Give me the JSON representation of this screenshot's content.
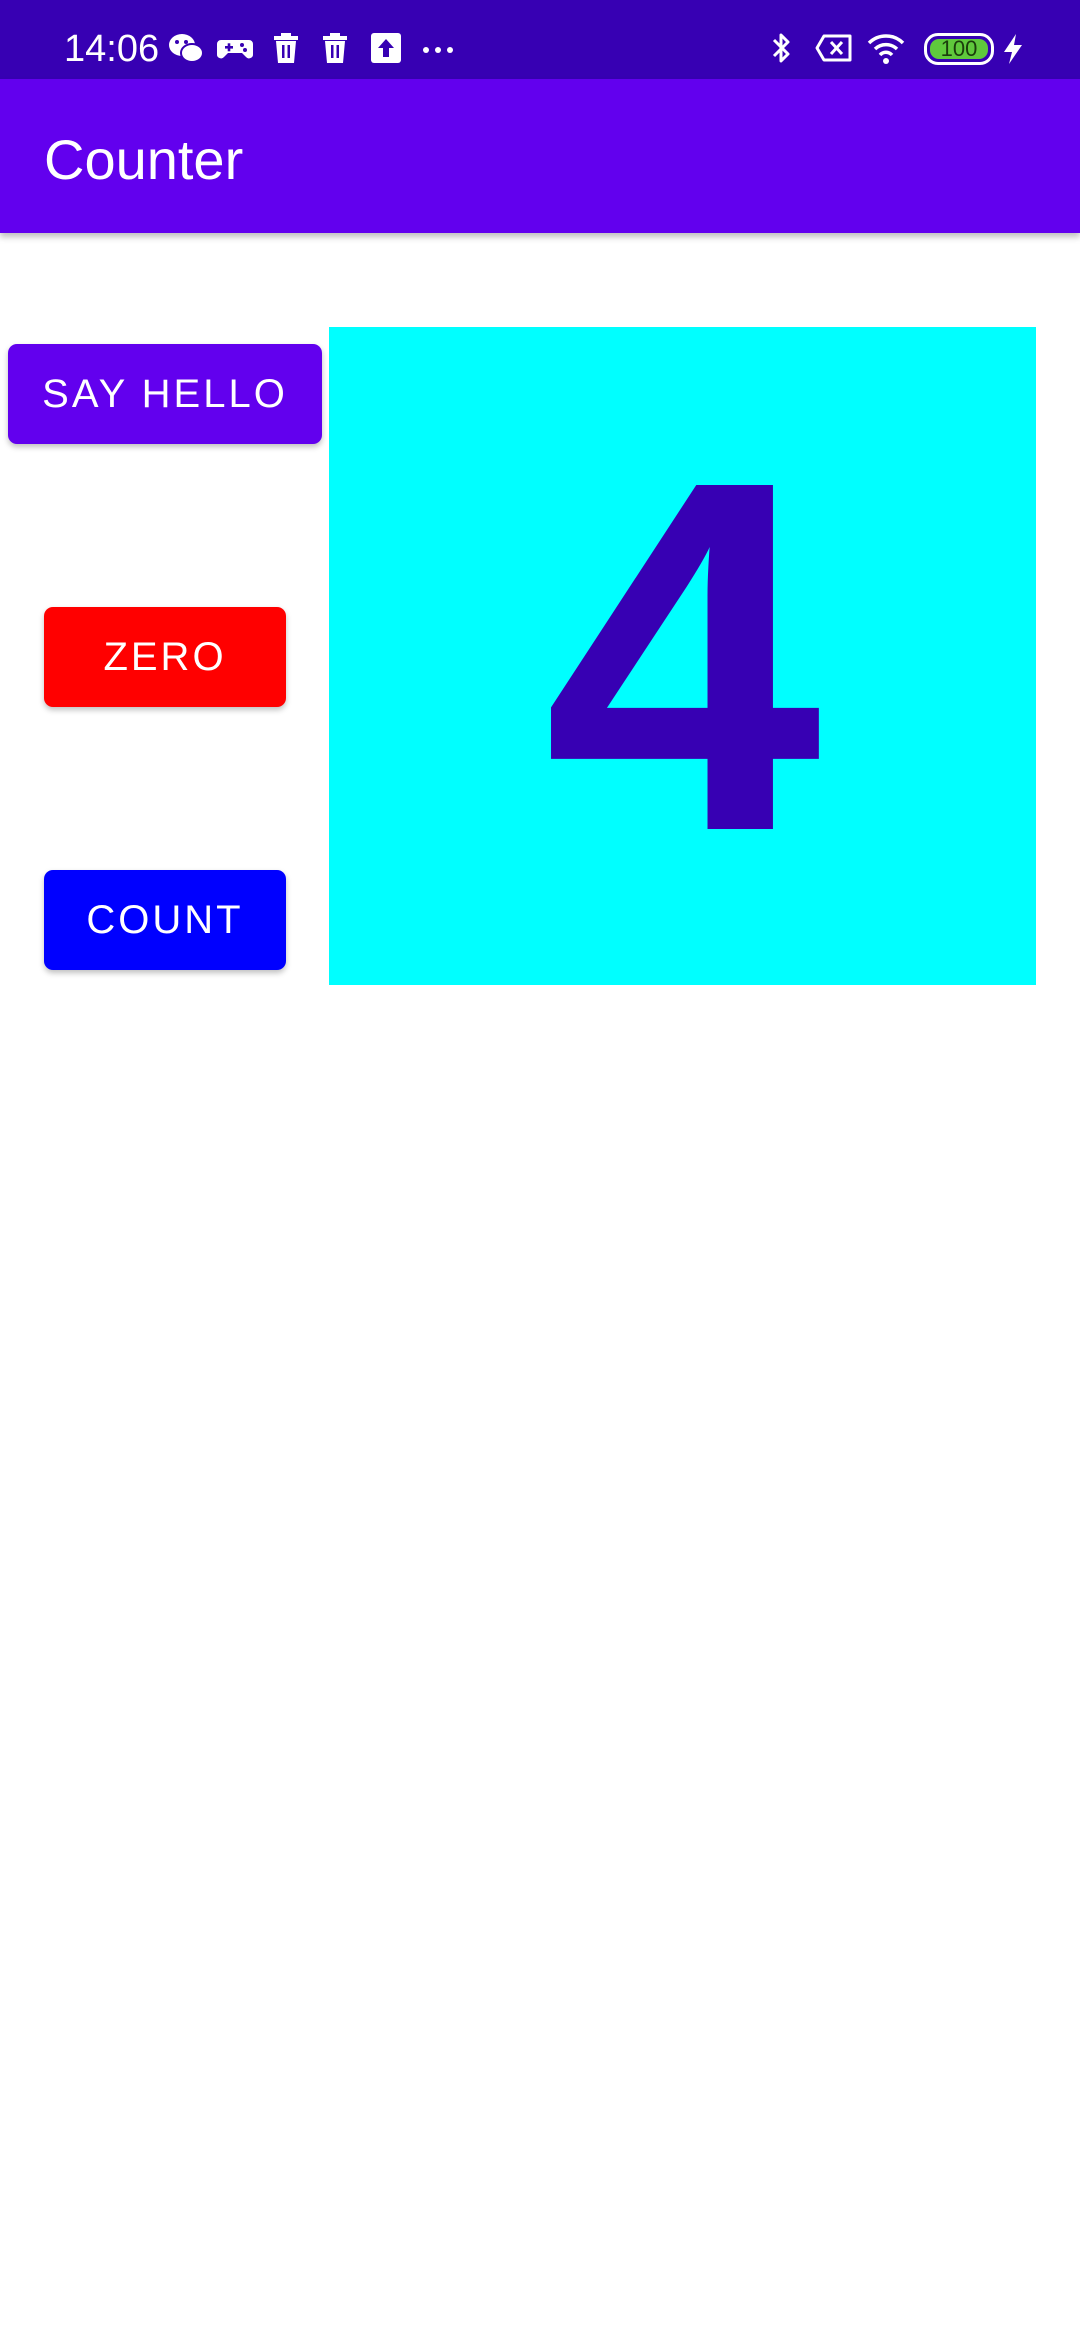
{
  "status_bar": {
    "time": "14:06",
    "battery_level": "100",
    "background_color": "#3700B3",
    "left_icons": [
      "wechat-icon",
      "gamepad-icon",
      "trash-icon",
      "trash-icon",
      "upload-icon",
      "more-dots-icon"
    ],
    "right_icons": [
      "bluetooth-icon",
      "sim-none-icon",
      "wifi-icon",
      "battery-icon",
      "charging-bolt-icon"
    ]
  },
  "app_bar": {
    "title": "Counter",
    "background_color": "#6200EE"
  },
  "buttons": {
    "say_hello": "SAY HELLO",
    "zero": "ZERO",
    "count": "COUNT"
  },
  "counter": {
    "value": "4",
    "box_color": "#00FFFF",
    "text_color": "#3700B3"
  },
  "colors": {
    "hello_button": "#6200EE",
    "zero_button": "#FF0000",
    "count_button": "#0000FF"
  }
}
